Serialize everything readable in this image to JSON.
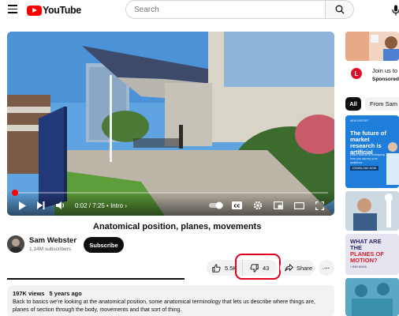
{
  "header": {
    "logo_text": "YouTube",
    "search_placeholder": "Search",
    "icons": [
      "menu-icon",
      "search-icon",
      "mic-icon"
    ]
  },
  "player": {
    "current_time": "0:02",
    "duration": "7:25",
    "chapter": "Intro",
    "progress_fraction": 0.0045,
    "icons": [
      "play-icon",
      "next-icon",
      "volume-icon",
      "autoplay-toggle",
      "captions-icon",
      "settings-icon",
      "miniplayer-icon",
      "theater-icon",
      "fullscreen-icon"
    ]
  },
  "video": {
    "title": "Anatomical position, planes, movements"
  },
  "channel": {
    "name": "Sam Webster",
    "subscribers": "1.14M subscribers",
    "subscribe_label": "Subscribe"
  },
  "actions": {
    "like_count": "5.5K",
    "dislike_count": "43",
    "share_label": "Share",
    "more_label": "···"
  },
  "description": {
    "views": "197K views",
    "age": "5 years ago",
    "text": "Back to basics we're looking at the anatomical position, some anatomical terminology that lets us describe where things are, planes of section through the body, movements and that sort of thing."
  },
  "sidebar": {
    "ad": {
      "title": "Join us to",
      "sponsored": "Sponsored",
      "logo_letter": "L"
    },
    "chips": [
      "All",
      "From Sam"
    ],
    "rec1": {
      "tag": "NEW REPORT",
      "title": "The future of market research is artificial",
      "subtitle": "Learn how AI is reshaping how you survey your audience",
      "button": "DOWNLOAD NOW"
    },
    "rec3": {
      "title_line1": "WHAT ARE THE",
      "title_line2": "PLANES OF MOTION?",
      "small": "+ RBY BOOK"
    }
  },
  "colors": {
    "brand_red": "#ff0000",
    "highlight_red": "#e0001b",
    "text": "#0f0f0f",
    "muted": "#606060",
    "pill_bg": "#f2f2f2"
  }
}
